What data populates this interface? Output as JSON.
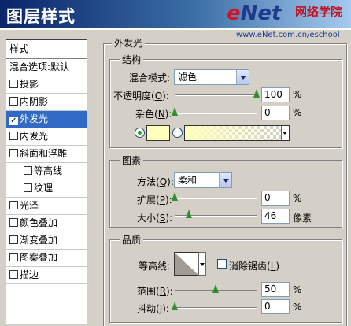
{
  "window": {
    "title": "图层样式",
    "watermark_logo_e": "e",
    "watermark_logo_net": "Net",
    "watermark_cn": "网络学院",
    "watermark_url": "www.eNet.com.cn/eschool"
  },
  "stylelist": {
    "header": "样式",
    "blend_options": "混合选项:默认",
    "items": [
      {
        "label": "投影",
        "checked": false,
        "selected": false,
        "indent": false
      },
      {
        "label": "内阴影",
        "checked": false,
        "selected": false,
        "indent": false
      },
      {
        "label": "外发光",
        "checked": true,
        "selected": true,
        "indent": false
      },
      {
        "label": "内发光",
        "checked": false,
        "selected": false,
        "indent": false
      },
      {
        "label": "斜面和浮雕",
        "checked": false,
        "selected": false,
        "indent": false
      },
      {
        "label": "等高线",
        "checked": false,
        "selected": false,
        "indent": true
      },
      {
        "label": "纹理",
        "checked": false,
        "selected": false,
        "indent": true
      },
      {
        "label": "光泽",
        "checked": false,
        "selected": false,
        "indent": false
      },
      {
        "label": "颜色叠加",
        "checked": false,
        "selected": false,
        "indent": false
      },
      {
        "label": "渐变叠加",
        "checked": false,
        "selected": false,
        "indent": false
      },
      {
        "label": "图案叠加",
        "checked": false,
        "selected": false,
        "indent": false
      },
      {
        "label": "描边",
        "checked": false,
        "selected": false,
        "indent": false
      }
    ]
  },
  "panel": {
    "title": "外发光",
    "structure": {
      "title": "结构",
      "blend_mode_label": "混合模式:",
      "blend_mode_value": "滤色",
      "opacity_label": "不透明度(",
      "opacity_key": "O",
      "opacity_suffix": "):",
      "opacity_value": "100",
      "opacity_level": 1.0,
      "noise_label": "杂色(",
      "noise_key": "N",
      "noise_suffix": "):",
      "noise_value": "0",
      "noise_level": 0.0,
      "glow_color": "#ffffbe",
      "unit": "%"
    },
    "elements": {
      "title": "图素",
      "method_label": "方法(",
      "method_key": "Q",
      "method_suffix": "):",
      "method_value": "柔和",
      "spread_label": "扩展(",
      "spread_key": "P",
      "spread_suffix": "):",
      "spread_value": "0",
      "spread_level": 0.0,
      "size_label": "大小(",
      "size_key": "S",
      "size_suffix": "):",
      "size_value": "46",
      "size_level": 0.18,
      "unit_pct": "%",
      "unit_px": "像素"
    },
    "quality": {
      "title": "品质",
      "contour_label": "等高线:",
      "antialias_label": "消除锯齿(",
      "antialias_key": "L",
      "antialias_suffix": ")",
      "range_label": "范围(",
      "range_key": "R",
      "range_suffix": "):",
      "range_value": "50",
      "range_level": 0.5,
      "jitter_label": "抖动(",
      "jitter_key": "J",
      "jitter_suffix": "):",
      "jitter_value": "0",
      "jitter_level": 0.0,
      "unit": "%"
    }
  }
}
